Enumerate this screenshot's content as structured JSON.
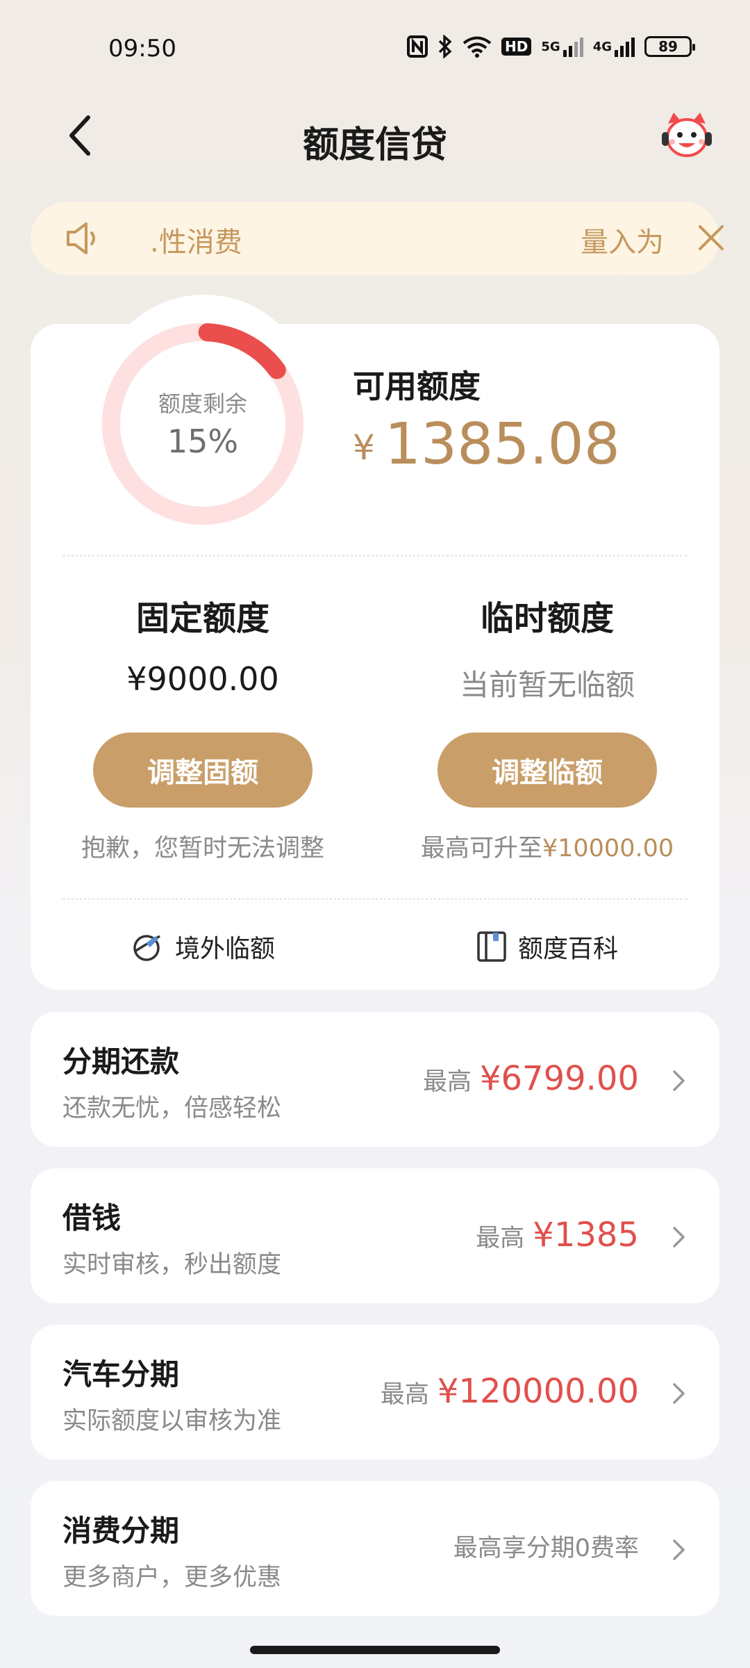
{
  "status_bar": {
    "time": "09:50",
    "icons": [
      "nfc-icon",
      "bluetooth-icon",
      "wifi-icon",
      "hd-icon",
      "signal-5g-icon",
      "signal-4g-icon"
    ],
    "hd_text": "HD",
    "net1": "5G",
    "net2": "4G",
    "battery": "89"
  },
  "nav": {
    "title": "额度信贷",
    "back_icon": "chevron-left-icon",
    "assistant_icon": "mascot-assistant-icon"
  },
  "notice": {
    "icon": "speaker-icon",
    "text_left": ".性消费",
    "text_right": "量入为",
    "close_icon": "close-icon"
  },
  "credit": {
    "ring_label": "额度剩余",
    "ring_percent": "15%",
    "remaining_fraction": 0.15,
    "available_label": "可用额度",
    "currency": "¥",
    "available_amount": "1385.08",
    "fixed": {
      "title": "固定额度",
      "value": "¥9000.00",
      "button": "调整固额",
      "note": "抱歉，您暂时无法调整"
    },
    "temporary": {
      "title": "临时额度",
      "value": "当前暂无临额",
      "button": "调整临额",
      "note_prefix": "最高可升至",
      "note_amount": "¥10000.00"
    },
    "links": [
      {
        "label": "境外临额",
        "icon": "globe-plane-icon"
      },
      {
        "label": "额度百科",
        "icon": "book-icon"
      }
    ]
  },
  "products": [
    {
      "title": "分期还款",
      "subtitle": "还款无忧，倍感轻松",
      "prefix": "最高",
      "amount": "¥6799.00"
    },
    {
      "title": "借钱",
      "subtitle": "实时审核，秒出额度",
      "prefix": "最高",
      "amount": "¥1385"
    },
    {
      "title": "汽车分期",
      "subtitle": "实际额度以审核为准",
      "prefix": "最高",
      "amount": "¥120000.00"
    },
    {
      "title": "消费分期",
      "subtitle": "更多商户，更多优惠",
      "prefix": "最高享分期0费率",
      "amount": ""
    }
  ],
  "colors": {
    "accent_gold": "#c99e68",
    "amount_gold": "#b98e5b",
    "amount_red": "#e0504d",
    "ring_track": "#fde0df",
    "ring_fill": "#ea4f4e"
  }
}
